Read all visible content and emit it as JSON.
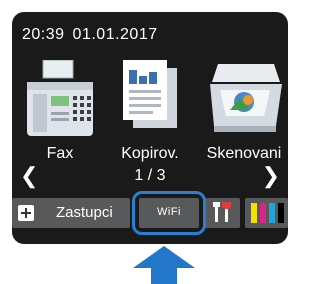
{
  "status": {
    "time": "20:39",
    "date": "01.01.2017"
  },
  "tiles": [
    {
      "label": "Fax",
      "icon": "fax-icon"
    },
    {
      "label": "Kopirov.",
      "icon": "copy-icon"
    },
    {
      "label": "Skenovani",
      "icon": "scanner-icon"
    }
  ],
  "pager": {
    "text": "1 / 3"
  },
  "bottom": {
    "shortcuts_label": "Zastupci",
    "wifi_label": "WiFi"
  },
  "colors": {
    "highlight": "#2a7fd1",
    "arrow": "#2277c8",
    "screen": "#1a1a1a",
    "button": "#58595b"
  }
}
